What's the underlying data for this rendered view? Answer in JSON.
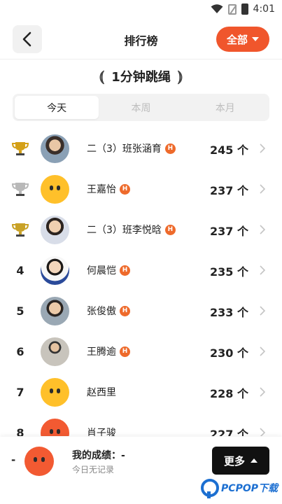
{
  "status_bar": {
    "time": "4:01"
  },
  "header": {
    "back_icon": "chevron-left-icon",
    "title": "排行榜",
    "filter_label": "全部"
  },
  "category": {
    "title": "1分钟跳绳"
  },
  "tabs": [
    {
      "label": "今天",
      "active": true
    },
    {
      "label": "本周",
      "active": false
    },
    {
      "label": "本月",
      "active": false
    }
  ],
  "leaderboard": [
    {
      "rank": "1",
      "rank_icon": "gold-trophy-icon",
      "name": "二（3）班张涵育",
      "badge": "H",
      "score": "245 个",
      "avatar": "photo"
    },
    {
      "rank": "2",
      "rank_icon": "silver-trophy-icon",
      "name": "王嘉怡",
      "badge": "H",
      "score": "237 个",
      "avatar": "emoji-yellow"
    },
    {
      "rank": "3",
      "rank_icon": "bronze-trophy-icon",
      "name": "二（3）班李悦晗",
      "badge": "H",
      "score": "237 个",
      "avatar": "photo"
    },
    {
      "rank": "4",
      "name": "何晨恺",
      "badge": "H",
      "score": "235 个",
      "avatar": "photo"
    },
    {
      "rank": "5",
      "name": "张俊傲",
      "badge": "H",
      "score": "233 个",
      "avatar": "photo"
    },
    {
      "rank": "6",
      "name": "王腾逾",
      "badge": "H",
      "score": "230 个",
      "avatar": "photo"
    },
    {
      "rank": "7",
      "name": "赵西里",
      "badge": "",
      "score": "228 个",
      "avatar": "emoji-yellow"
    },
    {
      "rank": "8",
      "name": "肖子骏",
      "badge": "",
      "score": "227 个",
      "avatar": "emoji-red"
    }
  ],
  "my_result": {
    "rank": "-",
    "label": "我的成绩：-",
    "subtitle": "今日无记录"
  },
  "more_button": {
    "label": "更多"
  },
  "watermark": {
    "text": "PCPOP下载"
  },
  "colors": {
    "accent": "#f0562c",
    "badge": "#ee6a2b",
    "gold": "#d4a017",
    "silver": "#b9b9b9",
    "bronze": "#c9a227"
  }
}
